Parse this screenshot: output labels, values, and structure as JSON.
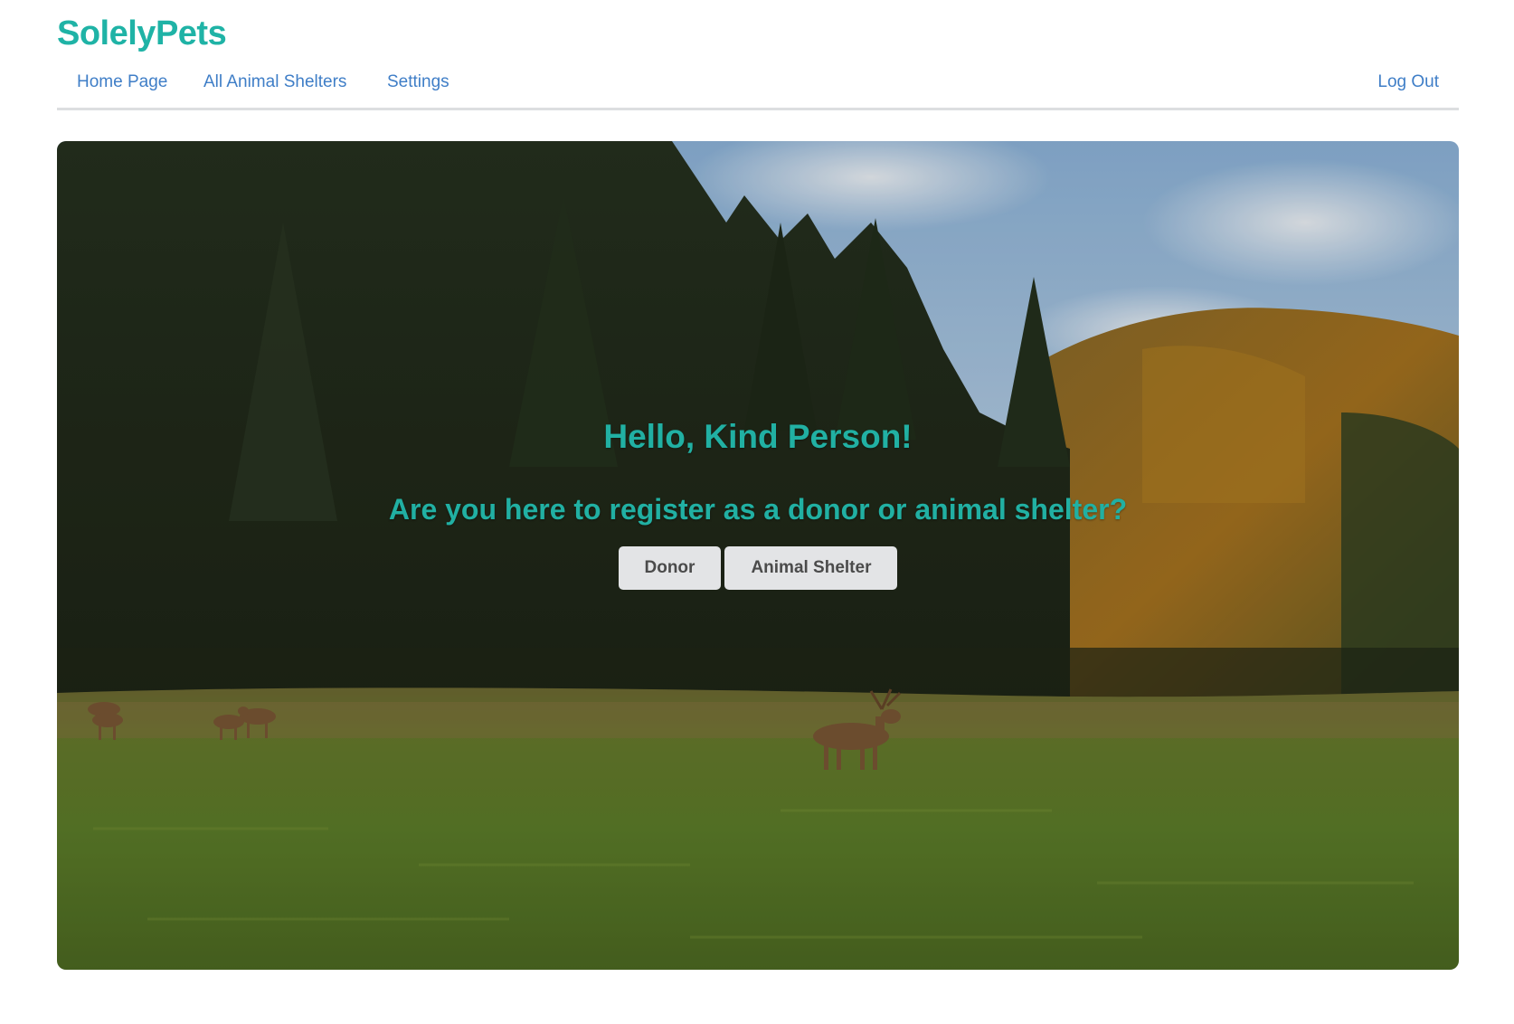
{
  "brand": {
    "name": "SolelyPets"
  },
  "nav": {
    "items": [
      {
        "label": "Home Page"
      },
      {
        "label": "All Animal Shelters"
      },
      {
        "label": "Settings"
      }
    ],
    "logout_label": "Log Out"
  },
  "hero": {
    "greeting": "Hello, Kind Person!",
    "question": "Are you here to register as a donor or animal shelter?",
    "buttons": [
      {
        "label": "Donor"
      },
      {
        "label": "Animal Shelter"
      }
    ]
  },
  "colors": {
    "brand_teal": "#1fb3a6",
    "nav_link": "#3f7ec7",
    "button_bg": "#e3e4e6"
  }
}
